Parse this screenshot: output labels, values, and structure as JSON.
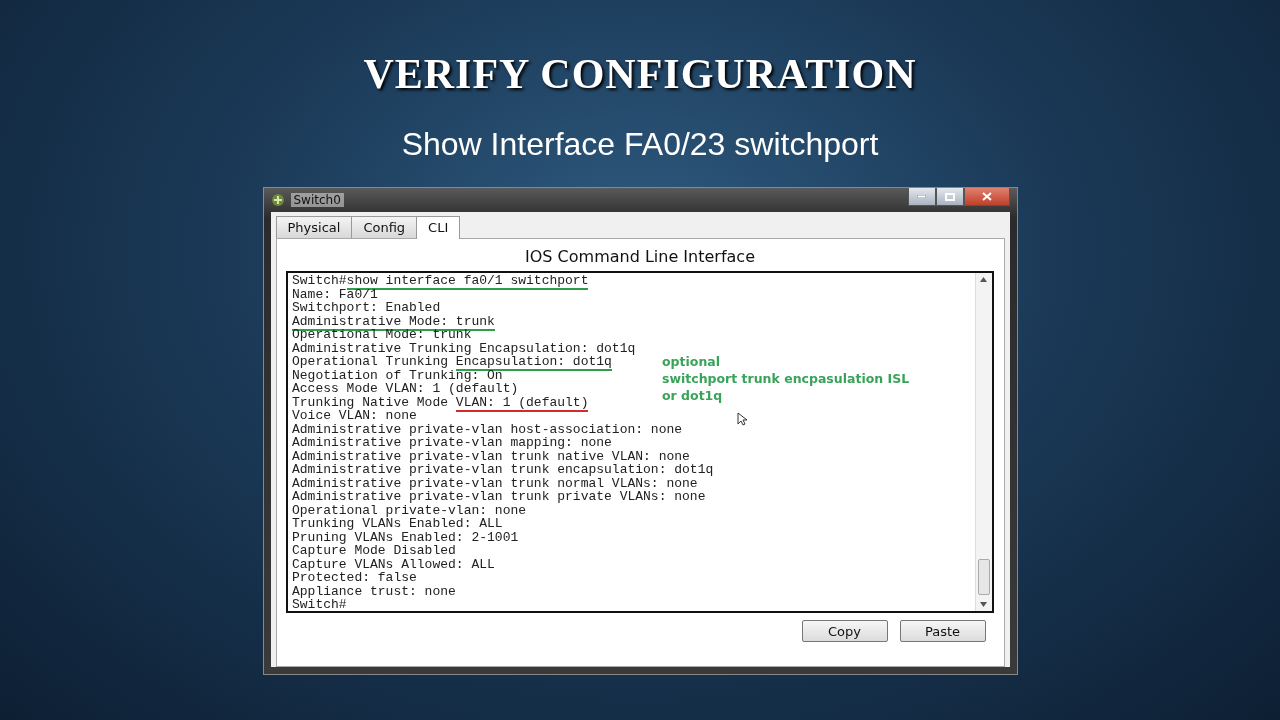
{
  "slide": {
    "title": "VERIFY CONFIGURATION",
    "subtitle": "Show Interface FA0/23 switchport"
  },
  "window": {
    "title": "Switch0",
    "tabs": [
      {
        "label": "Physical",
        "selected": false
      },
      {
        "label": "Config",
        "selected": false
      },
      {
        "label": "CLI",
        "selected": true
      }
    ],
    "heading": "IOS Command Line Interface",
    "terminal_lines": [
      {
        "segments": [
          {
            "text": "Switch#"
          },
          {
            "text": "show interface fa0/1 switchport",
            "color": "#2e9e4a"
          }
        ]
      },
      {
        "segments": [
          {
            "text": "Name: Fa0/1"
          }
        ]
      },
      {
        "segments": [
          {
            "text": "Switchport: Enabled"
          }
        ]
      },
      {
        "segments": [
          {
            "text": "Administrative Mode: trunk",
            "color": "#2e9e4a"
          }
        ]
      },
      {
        "segments": [
          {
            "text": "Operational Mode: trunk"
          }
        ]
      },
      {
        "segments": [
          {
            "text": "Administrative Trunking Encapsulation: dot1q"
          }
        ]
      },
      {
        "segments": [
          {
            "text": "Operational Trunking "
          },
          {
            "text": "Encapsulation: dot1q",
            "color": "#2e9e4a"
          }
        ]
      },
      {
        "segments": [
          {
            "text": "Negotiation of Trunking: On"
          }
        ]
      },
      {
        "segments": [
          {
            "text": "Access Mode VLAN: 1 (default)"
          }
        ]
      },
      {
        "segments": [
          {
            "text": "Trunking Native Mode "
          },
          {
            "text": "VLAN: 1 (default)",
            "color": "#d42a2a"
          }
        ]
      },
      {
        "segments": [
          {
            "text": "Voice VLAN: none"
          }
        ]
      },
      {
        "segments": [
          {
            "text": "Administrative private-vlan host-association: none"
          }
        ]
      },
      {
        "segments": [
          {
            "text": "Administrative private-vlan mapping: none"
          }
        ]
      },
      {
        "segments": [
          {
            "text": "Administrative private-vlan trunk native VLAN: none"
          }
        ]
      },
      {
        "segments": [
          {
            "text": "Administrative private-vlan trunk encapsulation: dot1q"
          }
        ]
      },
      {
        "segments": [
          {
            "text": "Administrative private-vlan trunk normal VLANs: none"
          }
        ]
      },
      {
        "segments": [
          {
            "text": "Administrative private-vlan trunk private VLANs: none"
          }
        ]
      },
      {
        "segments": [
          {
            "text": "Operational private-vlan: none"
          }
        ]
      },
      {
        "segments": [
          {
            "text": "Trunking VLANs Enabled: ALL"
          }
        ]
      },
      {
        "segments": [
          {
            "text": "Pruning VLANs Enabled: 2-1001"
          }
        ]
      },
      {
        "segments": [
          {
            "text": "Capture Mode Disabled"
          }
        ]
      },
      {
        "segments": [
          {
            "text": "Capture VLANs Allowed: ALL"
          }
        ]
      },
      {
        "segments": [
          {
            "text": "Protected: false"
          }
        ]
      },
      {
        "segments": [
          {
            "text": "Appliance trust: none"
          }
        ]
      },
      {
        "segments": [
          {
            "text": "Switch#"
          }
        ]
      }
    ],
    "annotation": [
      "optional",
      "switchport trunk encpasulation ISL",
      "or dot1q"
    ],
    "buttons": [
      "Copy",
      "Paste"
    ]
  }
}
